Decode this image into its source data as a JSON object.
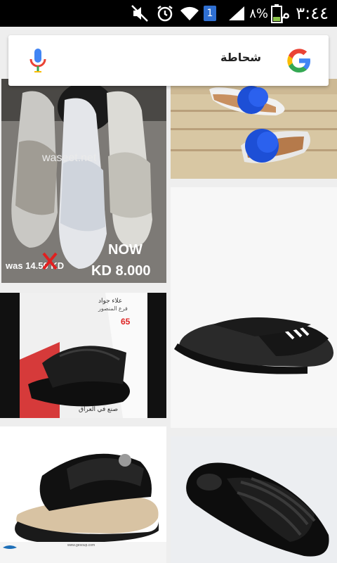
{
  "status_bar": {
    "time": "٣:٤٤ م",
    "battery_percent": "٨%",
    "sim_slot": "1",
    "icons": [
      "mute-icon",
      "alarm-icon",
      "wifi-icon",
      "sim-icon",
      "signal-icon",
      "battery-icon"
    ]
  },
  "search": {
    "query": "شحاطة"
  },
  "results": {
    "tile1": {
      "watermark": "waseet.net",
      "was_label": "was 14.50 KD",
      "now_label": "NOW",
      "price_label": "KD 8.000"
    },
    "tile4": {
      "size_label": "65",
      "top_label": "علاء جواد",
      "sub_label": "فرع المنصور",
      "bottom_label": "صنع في العراق"
    },
    "tile5": {
      "footer_text": "www.gesoup.com"
    }
  }
}
